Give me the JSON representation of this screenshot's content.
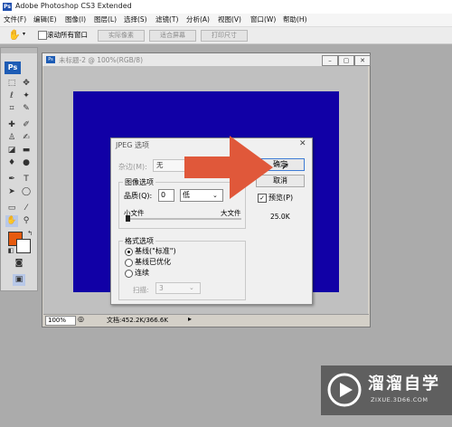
{
  "app": {
    "icon": "Ps",
    "title": "Adobe Photoshop CS3 Extended"
  },
  "menu": [
    "文件(F)",
    "编辑(E)",
    "图像(I)",
    "图层(L)",
    "选择(S)",
    "滤镜(T)",
    "分析(A)",
    "视图(V)",
    "窗口(W)",
    "帮助(H)"
  ],
  "options_bar": {
    "scroll_all_label": "滚动所有窗口",
    "actual_pixels": "实际像素",
    "fit_screen": "适合屏幕",
    "print_size": "打印尺寸"
  },
  "toolbox": {
    "logo": "Ps",
    "foreground_color": "#e65a0e",
    "background_color": "#ffffff"
  },
  "document": {
    "title": "未标题-2 @ 100%(RGB/8)",
    "canvas_color": "#1100a6",
    "zoom": "100%",
    "status": "文档:452.2K/366.6K"
  },
  "dialog": {
    "title": "JPEG 选项",
    "matte_label": "杂边(M):",
    "matte_value": "无",
    "image_options_legend": "图像选项",
    "quality_label": "品质(Q):",
    "quality_value": "0",
    "quality_level": "低",
    "small_file": "小文件",
    "large_file": "大文件",
    "format_legend": "格式选项",
    "format_options": [
      "基线(\"标准\")",
      "基线已优化",
      "连续"
    ],
    "selected_format": 0,
    "scans_label": "扫描:",
    "scans_value": "3",
    "ok": "确定",
    "cancel": "取消",
    "preview_label": "预览(P)",
    "preview_checked": true,
    "file_size": "25.0K"
  },
  "annotation": {
    "arrow_color": "#e0583a"
  },
  "watermark": {
    "text": "溜溜自学",
    "subtext": "ZIXUE.3D66.COM"
  }
}
